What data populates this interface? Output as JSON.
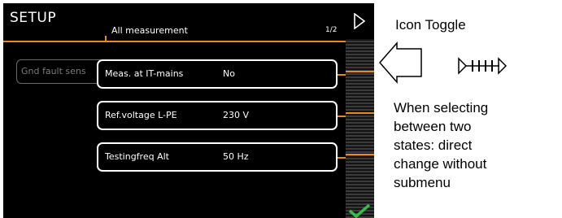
{
  "screen": {
    "title": "SETUP",
    "tab": "All measurement",
    "page_indicator": "1/2",
    "left_item": "Gnd fault sens",
    "params": [
      {
        "label": "Meas. at IT-mains",
        "value": "No"
      },
      {
        "label": "Ref.voltage L-PE",
        "value": "230 V"
      },
      {
        "label": "Testingfreq Alt",
        "value": "50 Hz"
      }
    ]
  },
  "side_strip": {
    "top_icon": "play-outline-icon",
    "bottom_icon": "checkmark-icon"
  },
  "callout": {
    "title": "Icon Toggle",
    "description_lines": [
      "When selecting",
      "between two",
      "states: direct",
      "change without",
      "submenu"
    ],
    "toggle_icon": "toggle-arrows-icon"
  },
  "colors": {
    "accent": "#e58a27",
    "check": "#3cb84a",
    "screen_bg": "#000000"
  }
}
